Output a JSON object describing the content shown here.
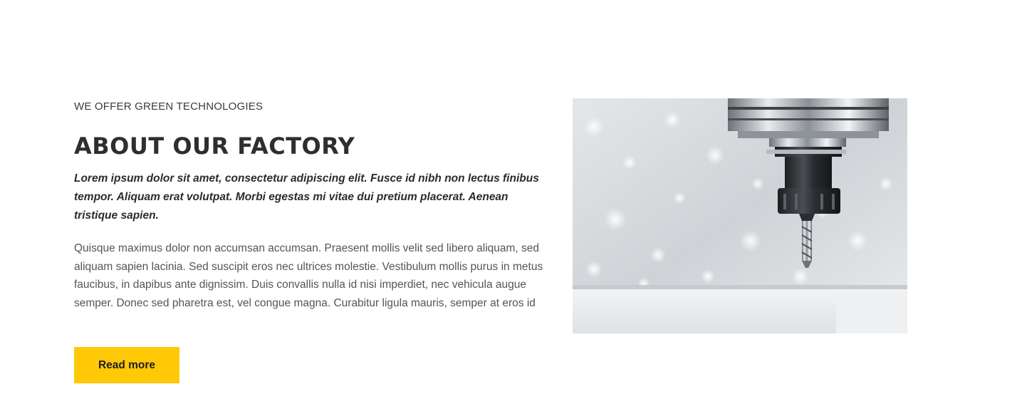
{
  "about": {
    "eyebrow": "WE OFFER GREEN TECHNOLOGIES",
    "title": "ABOUT OUR FACTORY",
    "lead": "Lorem ipsum dolor sit amet, consectetur adipiscing elit. Fusce id nibh non lectus finibus tempor. Aliquam erat volutpat. Morbi egestas mi vitae dui pretium placerat. Aenean tristique sapien.",
    "body": "Quisque maximus dolor non accumsan accumsan. Praesent mollis velit sed libero aliquam, sed aliquam sapien lacinia. Sed suscipit eros nec ultrices molestie. Vestibulum mollis purus in metus faucibus, in dapibus ante dignissim. Duis convallis nulla id nisi imperdiet, nec vehicula augue semper. Donec sed pharetra est, vel congue magna. Curabitur ligula mauris, semper at eros id",
    "button_label": "Read more",
    "image_subject": "cnc-milling-spindle-photo"
  },
  "colors": {
    "accent": "#ffc907",
    "heading": "#2e2e2e",
    "body_text": "#555555",
    "background": "#ffffff"
  }
}
